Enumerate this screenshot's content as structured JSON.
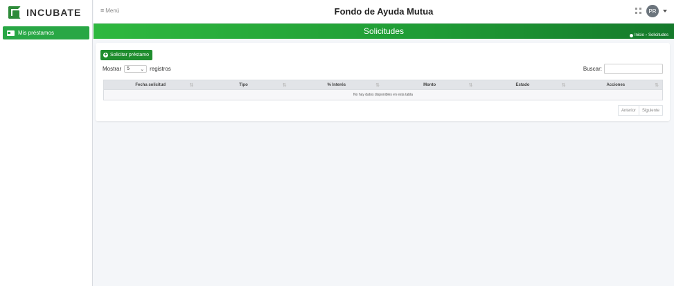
{
  "brand": {
    "name": "INCUBATE",
    "icon": "incubate-logo"
  },
  "sidebar": {
    "items": [
      {
        "label": "Mis préstamos",
        "icon": "card-icon",
        "active": true
      }
    ]
  },
  "topnav": {
    "menu_label": "Menú",
    "title": "Fondo de Ayuda Mutua",
    "user_initials": "PR"
  },
  "page": {
    "title": "Solicitudes",
    "breadcrumb": [
      "Inicio",
      "Solicitudes"
    ]
  },
  "actions": {
    "new_loan": "Solicitar préstamo"
  },
  "table_controls": {
    "show_prefix": "Mostrar",
    "show_value": "5",
    "show_suffix": "registros",
    "search_label": "Buscar:",
    "search_value": ""
  },
  "table": {
    "columns": [
      "Fecha solicitud",
      "Tipo",
      "% Interés",
      "Monto",
      "Estado",
      "Acciones"
    ],
    "empty_message": "No hay datos disponibles en esta tabla"
  },
  "pagination": {
    "previous": "Anterior",
    "next": "Siguiente"
  },
  "colors": {
    "accent": "#28a745",
    "band_start": "#2fb83f",
    "band_end": "#157a2b"
  }
}
